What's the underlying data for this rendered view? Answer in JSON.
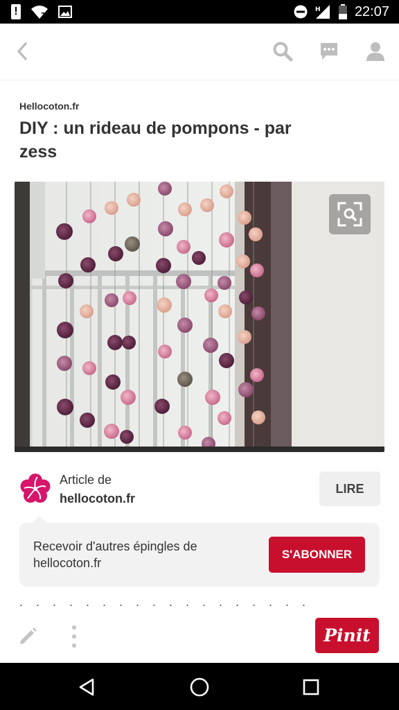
{
  "status_bar": {
    "time": "22:07",
    "icons": [
      "alert-icon",
      "wifi-icon",
      "image-icon",
      "do-not-disturb-icon",
      "signal-icon",
      "battery-icon"
    ]
  },
  "app_bar": {
    "icons": [
      "back-icon",
      "search-icon",
      "comment-icon",
      "profile-icon"
    ]
  },
  "pin": {
    "source": "Hellocoton.fr",
    "title": "DIY : un rideau de pompons - par zess"
  },
  "article": {
    "prefix": "Article de",
    "domain": "hellocoton.fr",
    "read_button": "LIRE"
  },
  "follow": {
    "text": "Recevoir d'autres épingles de hellocoton.fr",
    "subscribe_button": "S'ABONNER"
  },
  "actions": {
    "pin_it_button": "Pinit"
  },
  "colors": {
    "brand_red": "#c8102e",
    "text": "#333333",
    "card_bg": "#f2f2f2"
  }
}
